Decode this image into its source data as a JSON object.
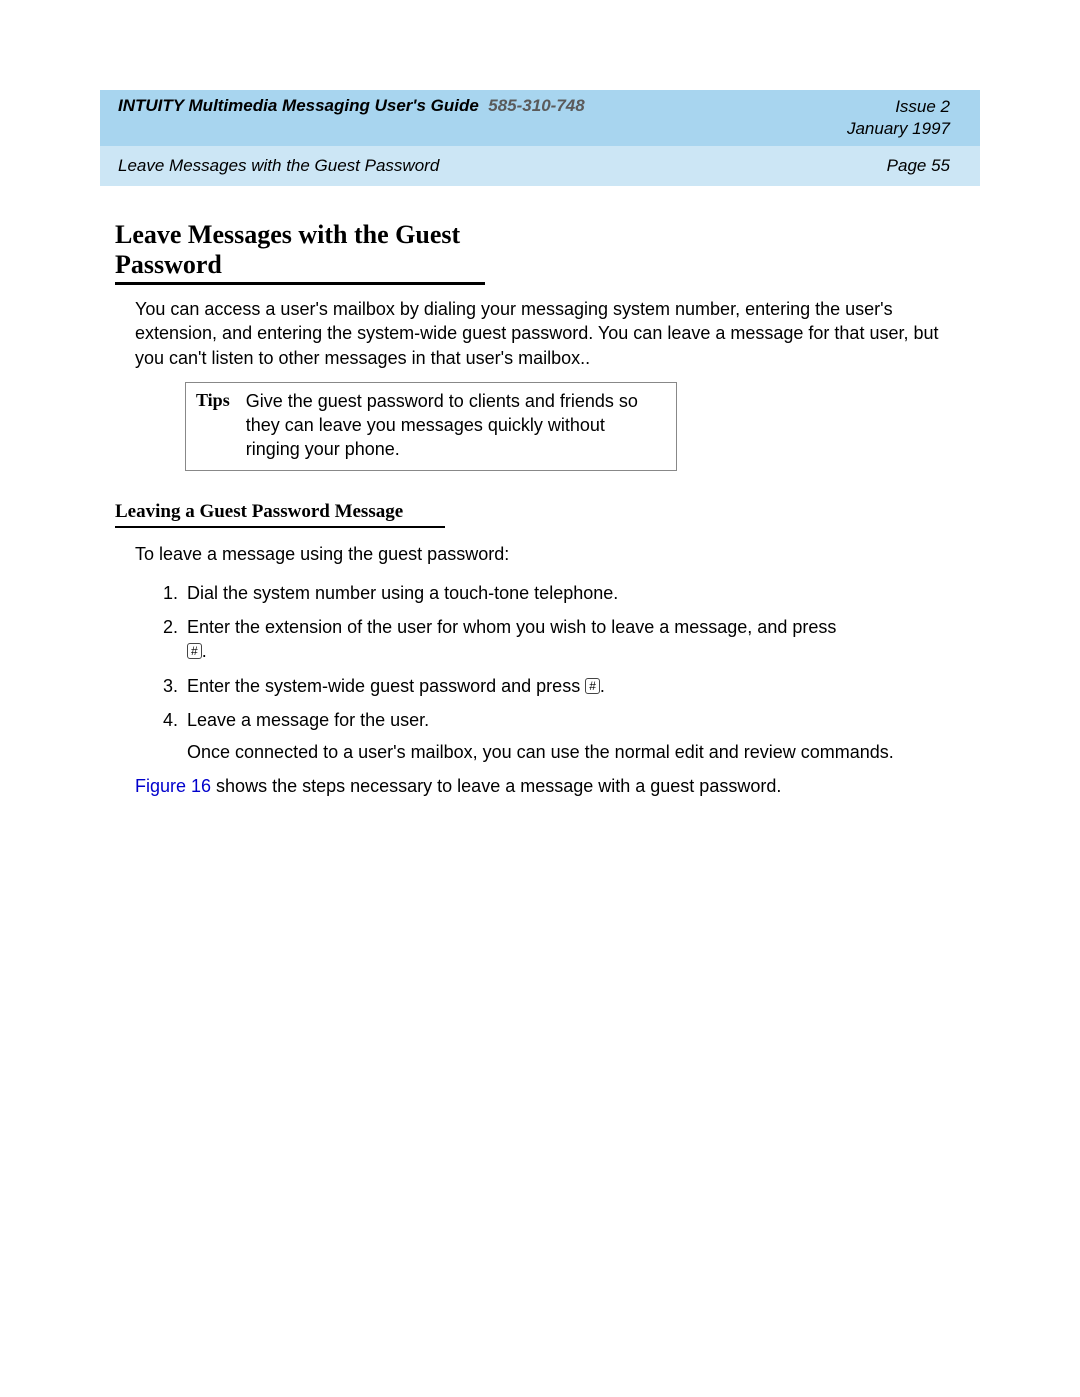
{
  "header": {
    "doc_title": "INTUITY Multimedia Messaging User's Guide",
    "doc_number": "585-310-748",
    "issue": "Issue 2",
    "date": "January 1997",
    "breadcrumb": "Leave Messages with the Guest Password",
    "page": "Page 55"
  },
  "section": {
    "title": "Leave Messages with the Guest Password",
    "intro": "You can access a user's mailbox by dialing your messaging system number, entering the user's extension, and entering the system-wide guest password. You can leave a message for that user, but you can't listen to other messages in that user's mailbox.."
  },
  "tips": {
    "label": "Tips",
    "text": "Give the guest password to clients and friends so they can leave you messages quickly without ringing your phone."
  },
  "subsection": {
    "heading": "Leaving a Guest Password Message",
    "lead": "To leave a message using the guest password:",
    "steps": {
      "s1": "Dial the system number using a touch-tone telephone.",
      "s2": "Enter the extension of the user for whom you wish to leave a message, and press",
      "s2_tail": ".",
      "s3a": "Enter the system-wide guest password and press ",
      "s3b": ".",
      "s4": "Leave a message for the user.",
      "s4_sub": "Once connected to a user's mailbox, you can use the normal edit and review commands."
    },
    "keycap": "#",
    "figref_link": "Figure 16",
    "figref_tail": " shows the steps necessary to leave a message with a guest password."
  }
}
